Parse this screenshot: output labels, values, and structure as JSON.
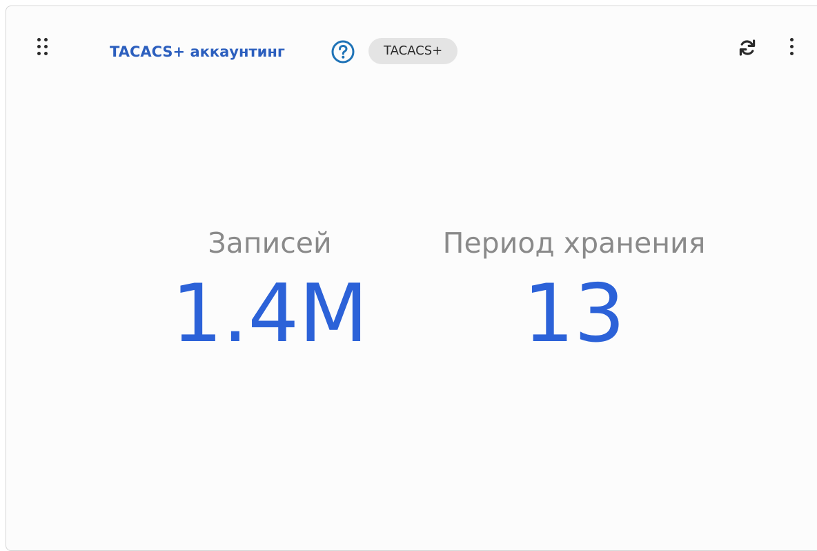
{
  "widget": {
    "title": "TACACS+ аккаунтинг",
    "badge": "TACACS+",
    "icons": {
      "drag": "drag-handle-icon",
      "help": "help-circle-icon",
      "refresh": "refresh-icon",
      "menu": "more-vertical-icon"
    }
  },
  "stats": {
    "records": {
      "label": "Записей",
      "value": "1.4M"
    },
    "retention": {
      "label": "Период хранения",
      "value": "13"
    }
  },
  "colors": {
    "title": "#2c5fbe",
    "value": "#2c62d8",
    "label": "#8a8a8a",
    "help_icon": "#1f73b7",
    "badge_bg": "#e4e4e4"
  }
}
